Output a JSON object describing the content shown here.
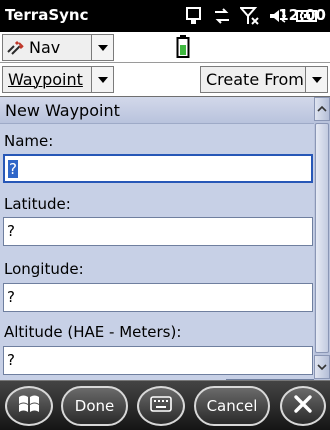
{
  "status_bar": {
    "app_title": "TerraSync",
    "time": "12:00",
    "icons": [
      "network-icon",
      "sync-icon",
      "no-signal-icon",
      "volume-icon",
      "battery-icon"
    ]
  },
  "nav_row": {
    "nav_label": "Nav",
    "nav_icon": "satellite-icon",
    "status_icon": "battery-status-icon"
  },
  "waypoint_row": {
    "section_select": "Waypoint",
    "create_from_select": "Create From"
  },
  "form": {
    "header": "New Waypoint",
    "fields": [
      {
        "label": "Name:",
        "value": "?"
      },
      {
        "label": "Latitude:",
        "value": "?"
      },
      {
        "label": "Longitude:",
        "value": "?"
      },
      {
        "label": "Altitude (HAE - Meters):",
        "value": "?"
      }
    ]
  },
  "softkeys": {
    "start_icon": "windows-start-icon",
    "done": "Done",
    "keyboard_icon": "keyboard-icon",
    "cancel": "Cancel",
    "close_icon": "close-icon"
  },
  "colors": {
    "form_background": "#c7d0e6",
    "focus_highlight": "#2f66c8",
    "bar_background": "#000000"
  }
}
